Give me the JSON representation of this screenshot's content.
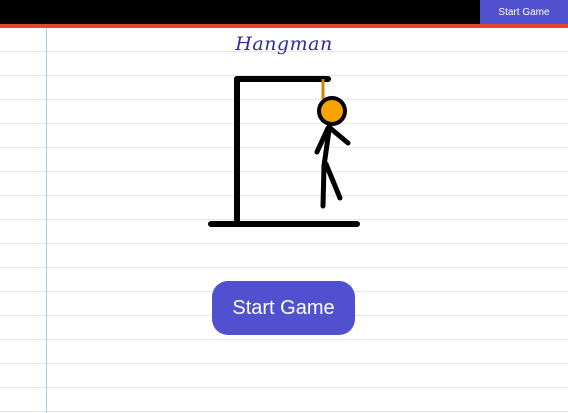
{
  "header": {
    "start_button_label": "Start Game"
  },
  "game": {
    "title": "Hangman",
    "start_button_label": "Start Game"
  },
  "colors": {
    "accent": "#5151cf",
    "topbar": "#000000",
    "topbar_line": "#e2482f",
    "head": "#f5a400",
    "rope": "#c8860a"
  },
  "icons": [
    "hangman-figure-icon"
  ]
}
